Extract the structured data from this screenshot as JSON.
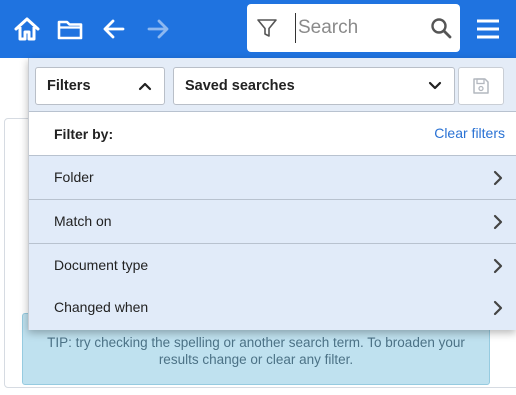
{
  "topbar": {
    "bg_color": "#1f73e0",
    "home_icon": "home-icon",
    "folder_icon": "folder-icon",
    "back_icon": "arrow-left-icon",
    "forward_icon": "arrow-right-icon",
    "menu_icon": "hamburger-menu-icon"
  },
  "search": {
    "placeholder": "Search",
    "value": "",
    "filter_icon": "funnel-icon",
    "search_icon": "magnifier-icon"
  },
  "panel": {
    "filters_label": "Filters",
    "filters_icon": "chevron-up-icon",
    "saved_searches_label": "Saved searches",
    "saved_searches_icon": "chevron-down-icon",
    "save_icon": "floppy-disk-icon",
    "filter_by_label": "Filter by:",
    "clear_filters_label": "Clear filters",
    "options": [
      {
        "label": "Folder"
      },
      {
        "label": "Match on"
      },
      {
        "label": "Document type"
      },
      {
        "label": "Changed when"
      }
    ]
  },
  "tip": {
    "text": "TIP: try checking the spelling or another search term. To broaden your results change or clear any filter."
  }
}
